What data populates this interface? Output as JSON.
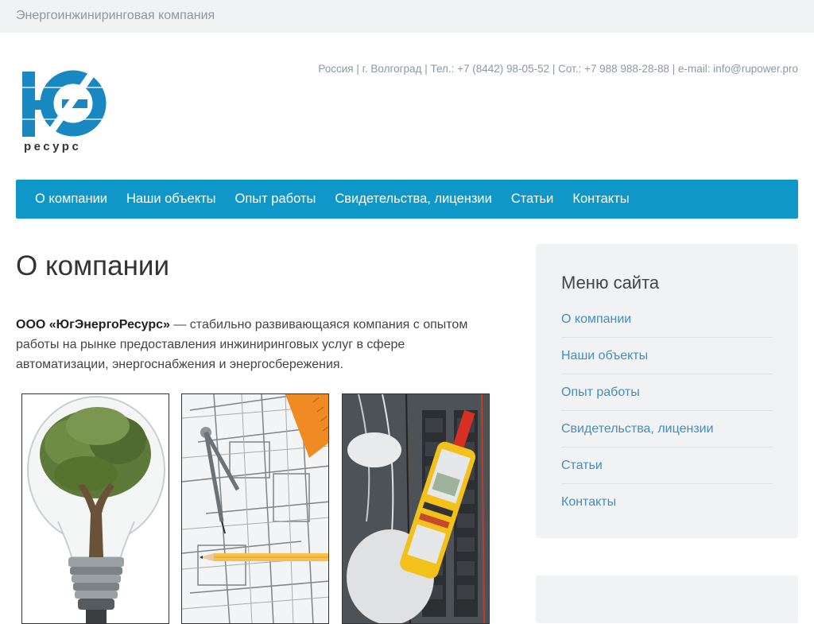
{
  "header": {
    "tagline": "Энергоинжиниринговая компания",
    "contacts": "Россия | г. Волгоград | Тел.: +7 (8442) 98-05-52 | Сот.: +7 988 988-28-88 | e-mail: info@rupower.pro",
    "logo_text": "ресурс"
  },
  "nav": {
    "items": [
      {
        "label": "О компании"
      },
      {
        "label": "Наши объекты"
      },
      {
        "label": "Опыт работы"
      },
      {
        "label": "Свидетельства, лицензии"
      },
      {
        "label": "Статьи"
      },
      {
        "label": "Контакты"
      }
    ]
  },
  "main": {
    "title": "О компании",
    "intro_company": "ООО «ЮгЭнергоРесурс»",
    "intro_text": " — стабильно развивающаяся компания с опытом работы на рынке предоставления инжиниринговых услуг в сфере автоматизации, энергоснабжения и энергосбережения.",
    "images": [
      {
        "icon": "lightbulb-tree-image"
      },
      {
        "icon": "blueprint-compass-image"
      },
      {
        "icon": "electrician-tester-image"
      }
    ]
  },
  "sidebar": {
    "title": "Меню сайта",
    "items": [
      {
        "label": "О компании"
      },
      {
        "label": "Наши объекты"
      },
      {
        "label": "Опыт работы"
      },
      {
        "label": "Свидетельства, лицензии"
      },
      {
        "label": "Статьи"
      },
      {
        "label": "Контакты"
      }
    ]
  },
  "colors": {
    "nav_bg": "#0f97c9",
    "link": "#3f8fc0",
    "panel_bg": "#f1f2f4",
    "logo": "#1a88c0"
  }
}
